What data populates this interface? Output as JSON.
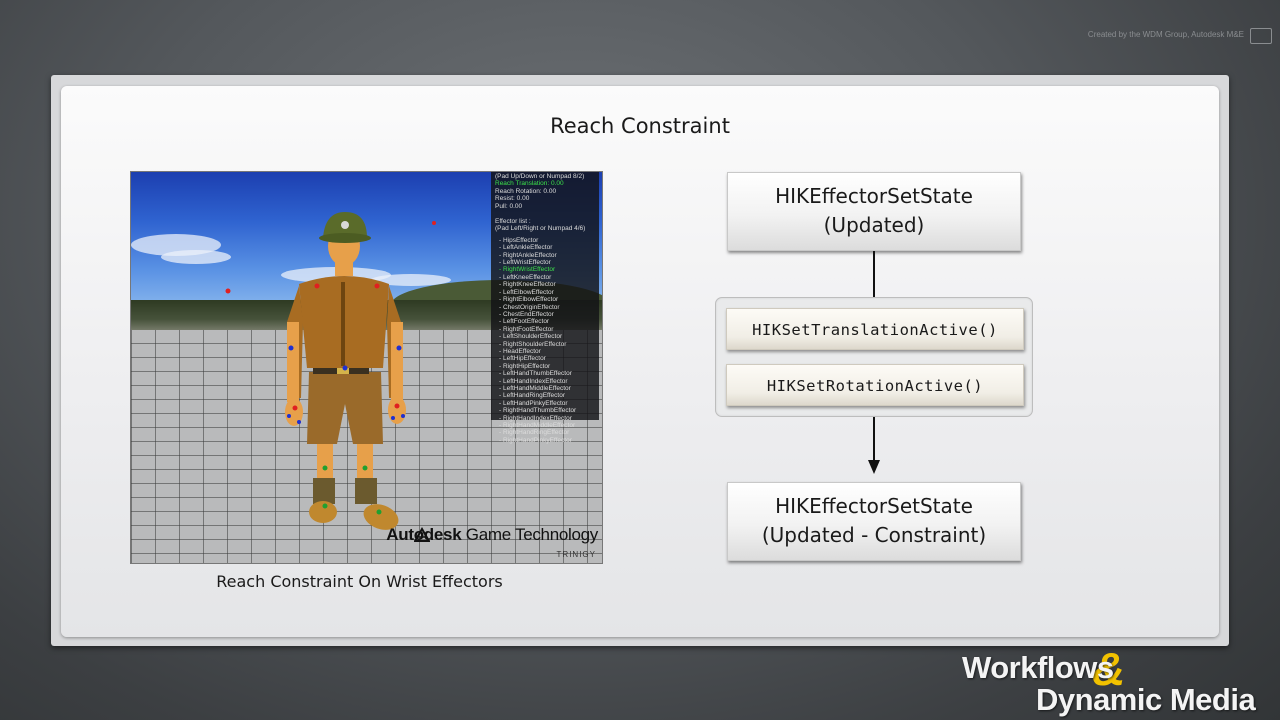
{
  "header": {
    "credit": "Created by the WDM Group, Autodesk M&E"
  },
  "slide": {
    "title": "Reach Constraint",
    "caption": "Reach Constraint On Wrist Effectors"
  },
  "viewport": {
    "hud": {
      "line1": "(Pad Up/Down or Numpad 8/2)",
      "line2": "Reach Translation: 0.00",
      "line3": "Reach Rotation: 0.00",
      "line4": "Resist: 0.00",
      "line5": "Pull: 0.00",
      "list_title": "Effector list :",
      "list_hint": "(Pad Left/Right or Numpad 4/6)",
      "effectors": [
        "- HipsEffector",
        "- LeftAnkleEffector",
        "- RightAnkleEffector",
        "- LeftWristEffector",
        "- RightWristEffector",
        "- LeftKneeEffector",
        "- RightKneeEffector",
        "- LeftElbowEffector",
        "- RightElbowEffector",
        "- ChestOriginEffector",
        "- ChestEndEffector",
        "- LeftFootEffector",
        "- RightFootEffector",
        "- LeftShoulderEffector",
        "- RightShoulderEffector",
        "- HeadEffector",
        "- LeftHipEffector",
        "- RightHipEffector",
        "- LeftHandThumbEffector",
        "- LeftHandIndexEffector",
        "- LeftHandMiddleEffector",
        "- LeftHandRingEffector",
        "- LeftHandPinkyEffector",
        "- RightHandThumbEffector",
        "- RightHandIndexEffector",
        "- RightHandMiddleEffector",
        "- RightHandRingEffector",
        "- RightHandPinkyEffector"
      ],
      "selected_index": 4
    },
    "brand": {
      "autodesk": "Autodesk",
      "game_tech": " Game Technology",
      "sub": "TRINIGY"
    }
  },
  "flow": {
    "top_box": {
      "line1": "HIKEffectorSetState",
      "line2": "(Updated)"
    },
    "func1": "HIKSetTranslationActive()",
    "func2": "HIKSetRotationActive()",
    "bottom_box": {
      "line1": "HIKEffectorSetState",
      "line2": "(Updated - Constraint)"
    }
  },
  "footer_logo": {
    "line1": "Workflows",
    "amp": "&",
    "line2": "Dynamic Media"
  },
  "colors": {
    "hud_highlight": "#3ce04a",
    "logo_amp": "#f2c200",
    "arrow": "#111111"
  }
}
